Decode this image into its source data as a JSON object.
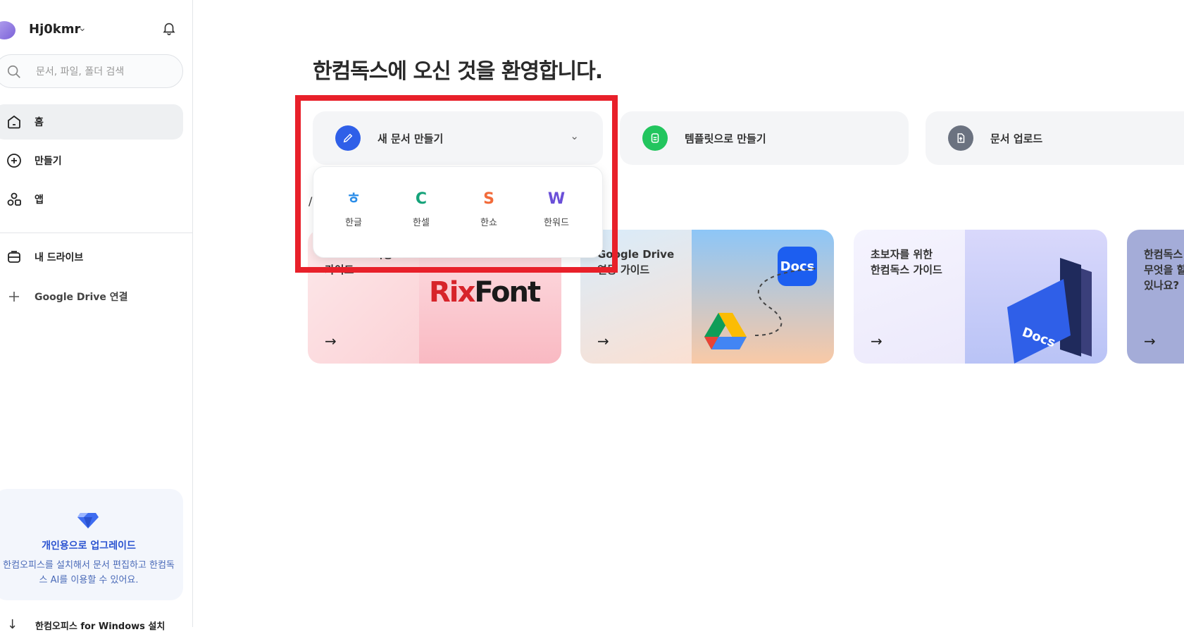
{
  "sidebar": {
    "profile_name": "Hj0kmr",
    "search_placeholder": "문서, 파일, 폴더 검색",
    "nav": [
      {
        "label": "홈"
      },
      {
        "label": "만들기"
      },
      {
        "label": "앱"
      },
      {
        "label": "내 드라이브"
      },
      {
        "label": "Google Drive 연결"
      }
    ],
    "upgrade": {
      "title": "개인용으로 업그레이드",
      "desc": "한컴오피스를 설치해서 문서 편집하고 한컴독스 AI를 이용할 수 있어요."
    },
    "install_label": "한컴오피스 for Windows 설치"
  },
  "main": {
    "welcome": "한컴독스에 오신 것을 환영합니다.",
    "actions": [
      {
        "label": "새 문서 만들기",
        "color": "#2f5fe8"
      },
      {
        "label": "템플릿으로 만들기",
        "color": "#22c55e"
      },
      {
        "label": "문서 업로드",
        "color": "#6b7280"
      }
    ],
    "dropdown": [
      {
        "letter": "ㅎ",
        "name": "한글",
        "color": "#2b8de8"
      },
      {
        "letter": "C",
        "name": "한셀",
        "color": "#16a37a"
      },
      {
        "letter": "S",
        "name": "한쇼",
        "color": "#f26b3a"
      },
      {
        "letter": "W",
        "name": "한워드",
        "color": "#6a4fd8"
      }
    ],
    "banners": [
      {
        "title": "RixFont 사용\n가이드",
        "logo_a": "Rix",
        "logo_b": "Font"
      },
      {
        "title": "Google Drive\n연동 가이드",
        "badge": "Docs"
      },
      {
        "title": "초보자를 위한\n한컴독스 가이드"
      },
      {
        "title": "한컴독스\n무엇을 할\n있나요?"
      }
    ],
    "arrow": "→"
  }
}
